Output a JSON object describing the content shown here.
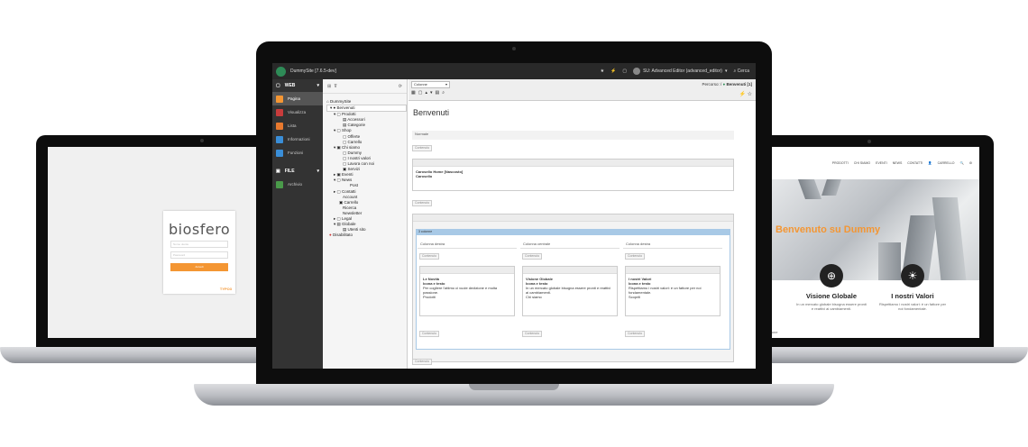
{
  "login": {
    "logo": "biosfero",
    "username_placeholder": "Nome utente",
    "password_placeholder": "Password",
    "submit_label": "Accedi",
    "footer_brand": "TYPO3"
  },
  "website": {
    "nav": [
      "PRODOTTI",
      "CHI SIAMO",
      "EVENTI",
      "NEWS",
      "CONTATTI",
      "👤",
      "CARRELLO",
      "🔍",
      "⚙"
    ],
    "hero_title": "Benvenuto su Dummy",
    "features": [
      {
        "title": "Visione Globale",
        "text": "In un mercato globale bisogna essere pronti e reattivi ai cambiamenti.",
        "icon": "globe-icon"
      },
      {
        "title": "I nostri Valori",
        "text": "Rispettiamo i nostri valori: è un fattore per noi fondamentale.",
        "icon": "bulb-icon"
      }
    ],
    "partial_text": "izione"
  },
  "backend": {
    "site_title": "DummySite [7.6.5-dev]",
    "user_label": "SU: Advanced Editor (advanced_editor)",
    "search_label": "Cerca",
    "modules": {
      "web_group": "WEB",
      "web_items": [
        "Pagina",
        "Visualizza",
        "Lista",
        "Informazioni",
        "Funzioni"
      ],
      "file_group": "FILE",
      "file_items": [
        "Archivio"
      ]
    },
    "tree": [
      "DummySite",
      "Benvenuti",
      "Prodotti",
      "Accessori",
      "Categorie",
      "Shop",
      "Offerte",
      "Carrello",
      "Chi siamo",
      "Dummy",
      "I nostri valori",
      "Lavora con noi",
      "Servizi",
      "Eventi",
      "News",
      "Post",
      "Contatti",
      "Account",
      "Carrello",
      "Ricerca",
      "Newsletter",
      "Legal",
      "Globale",
      "Utenti sito",
      "Disabilitato"
    ],
    "language_select": "Colonne",
    "breadcrumb_prefix": "Percorso: /",
    "breadcrumb_page": "Benvenuti [1]",
    "page_title": "Benvenuti",
    "colpos_normale": "Normale",
    "btn_content": "Contenuto",
    "ce_carousel_title": "Carosello Home [Nascosto]",
    "ce_carousel_sub": "Carosello",
    "grid_label": "3 colonne",
    "columns": [
      {
        "head": "Colonna destra",
        "title": "Le Novità",
        "type": "Icona e testo",
        "text": "Per cogliere l'attimo ci vuole dedizione e molta passione.",
        "link": "Prodotti"
      },
      {
        "head": "Colonna centrale",
        "title": "Visione Globale",
        "type": "Icona e testo",
        "text": "In un mercato globale bisogna essere pronti e reattivi ai cambiamenti.",
        "link": "Chi siamo"
      },
      {
        "head": "Colonna destra",
        "title": "I nostri Valori",
        "type": "Icona e testo",
        "text": "Rispettiamo i nostri valori: è un fattore per noi fondamentale.",
        "link": "Scoprili"
      }
    ]
  }
}
